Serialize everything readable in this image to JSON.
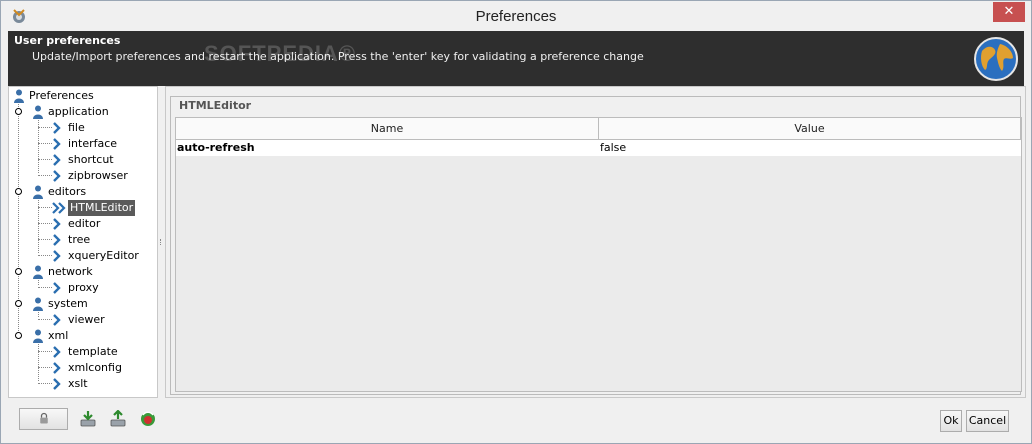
{
  "window": {
    "title": "Preferences",
    "close_glyph": "✕"
  },
  "header": {
    "title": "User preferences",
    "description": "Update/Import preferences and restart the application. Press the 'enter' key for validating a preference change",
    "watermark": "SOFTPEDIA®"
  },
  "tree": {
    "root": "Preferences",
    "groups": [
      {
        "label": "application",
        "children": [
          "file",
          "interface",
          "shortcut",
          "zipbrowser"
        ]
      },
      {
        "label": "editors",
        "children": [
          "HTMLEditor",
          "editor",
          "tree",
          "xqueryEditor"
        ]
      },
      {
        "label": "network",
        "children": [
          "proxy"
        ]
      },
      {
        "label": "system",
        "children": [
          "viewer"
        ]
      },
      {
        "label": "xml",
        "children": [
          "template",
          "xmlconfig",
          "xslt"
        ]
      }
    ],
    "selected": "HTMLEditor"
  },
  "panel": {
    "group_title": "HTMLEditor",
    "columns": [
      "Name",
      "Value"
    ],
    "rows": [
      {
        "name": "auto-refresh",
        "value": "false"
      }
    ]
  },
  "footer": {
    "ok_label": "Ok",
    "cancel_label": "Cancel"
  },
  "icons": {
    "app": "gear-globe-icon",
    "header": "globe-icon",
    "tree_node": "person-icon",
    "leaf": "chevron-right-icon",
    "selected_leaf": "double-chevron-right-icon",
    "tools": [
      "lock-icon",
      "import-icon",
      "export-icon",
      "reset-icon"
    ]
  },
  "colors": {
    "header_bg": "#2e2e2e",
    "selection_bg": "#5a5a5a",
    "close_bg": "#c75050",
    "chevron": "#2a6eb0"
  }
}
